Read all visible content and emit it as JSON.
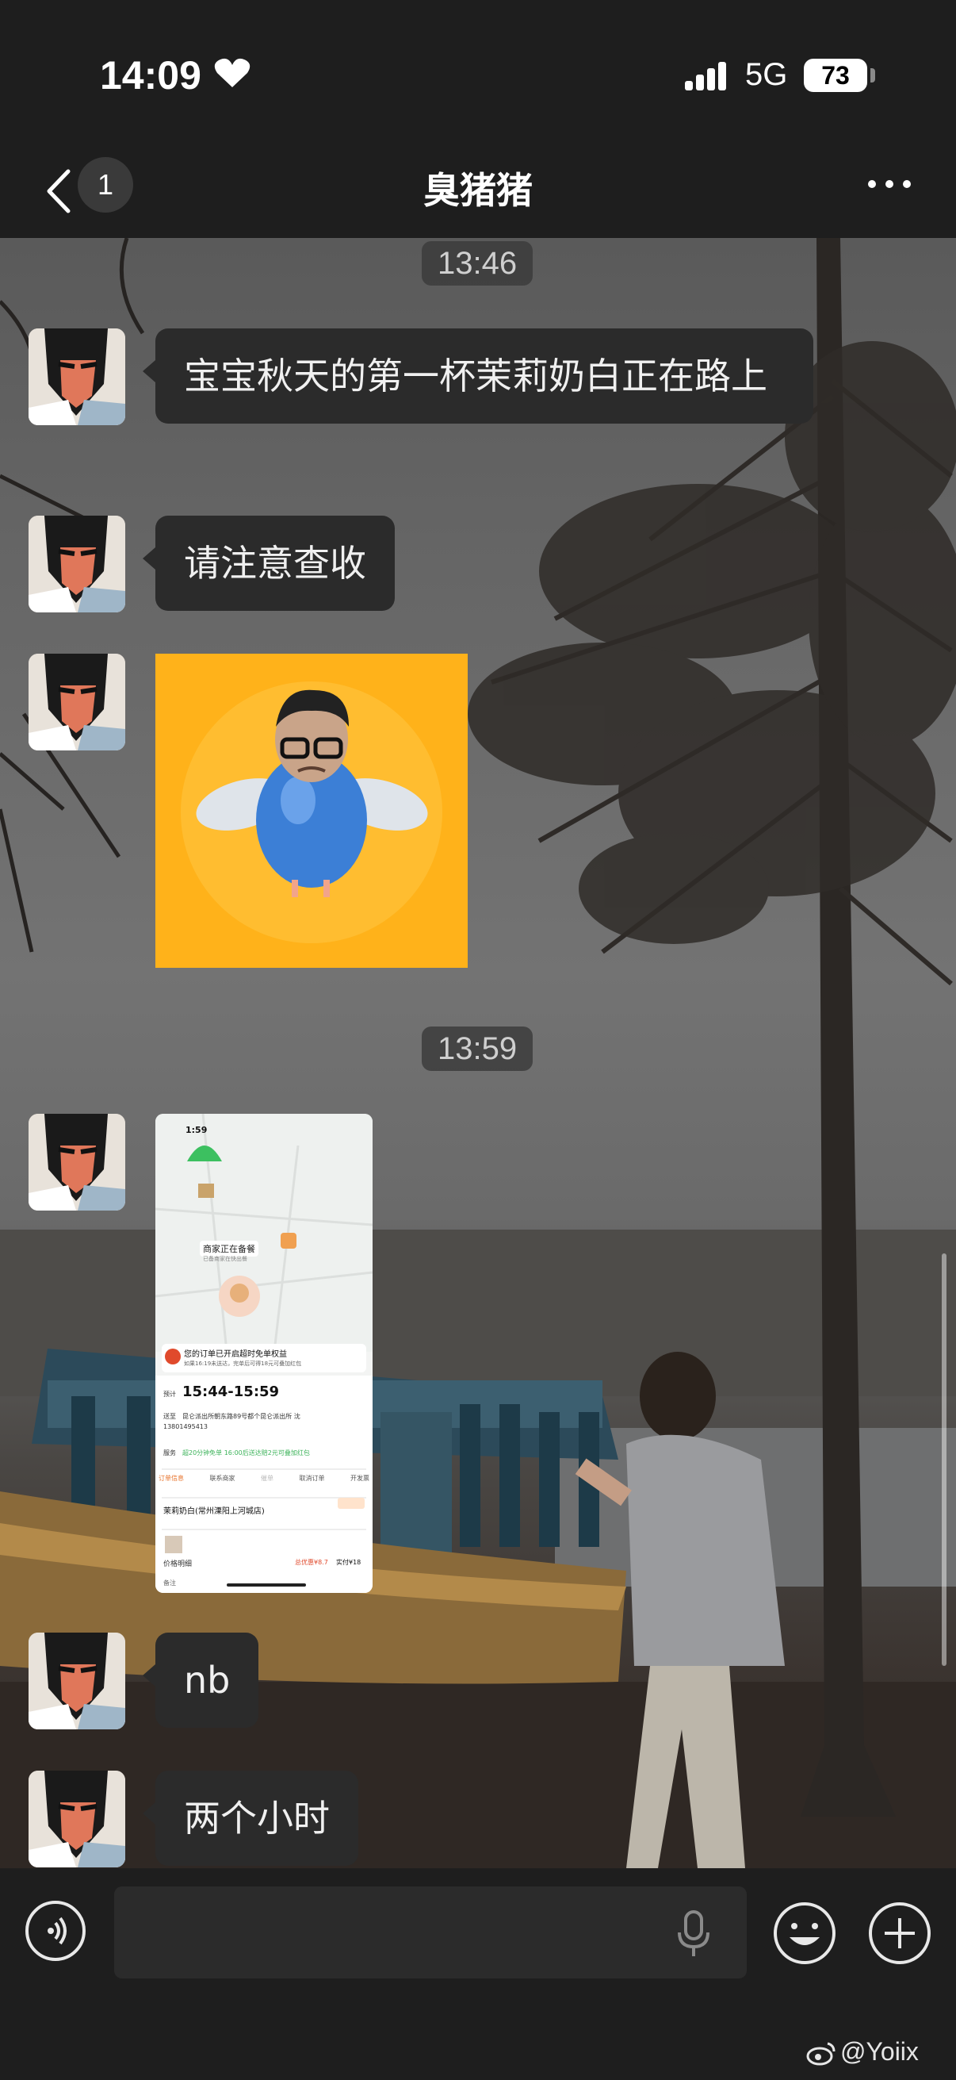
{
  "status_bar": {
    "time": "14:09",
    "network": "5G",
    "battery": "73"
  },
  "nav": {
    "unread_count": "1",
    "title": "臭猪猪"
  },
  "chat": {
    "timestamps": [
      "13:46",
      "13:59"
    ],
    "messages": [
      {
        "type": "text",
        "text": "宝宝秋天的第一杯茉莉奶白正在路上"
      },
      {
        "type": "text",
        "text": "请注意查收"
      },
      {
        "type": "sticker"
      },
      {
        "type": "image"
      },
      {
        "type": "text",
        "text": "nb"
      },
      {
        "type": "text",
        "text": "两个小时"
      }
    ]
  },
  "order_screenshot": {
    "time": "1:59",
    "merchant_status": "商家正在备餐",
    "merchant_sub": "已备商家在快出餐",
    "banner_title": "您的订单已开启超时免单权益",
    "banner_sub": "如果16:19未送达，完单后可得18元可叠加红包",
    "eta_label": "预计",
    "eta": "15:44-15:59",
    "address_label": "送至",
    "address": "昆仑派出所朝东路89号都个昆仑派出所 沈",
    "phone": "13801495413",
    "service_label": "服务",
    "service": "超20分钟免单 16:00后送达赔2元可叠加红包",
    "actions": [
      "订单信息",
      "联系商家",
      "催单",
      "取消订单",
      "开发票"
    ],
    "shop": "茉莉奶白(常州溧阳上河城店)",
    "price_label": "价格明细",
    "price_total": "总优惠¥8.7",
    "price_paid": "实付¥18",
    "footer": "备注"
  },
  "watermark": "@Yoiix",
  "colors": {
    "bubble": "#2b2b2b",
    "sticker_bg": "#ffb21a",
    "bar_bg": "#1e1e1e"
  }
}
